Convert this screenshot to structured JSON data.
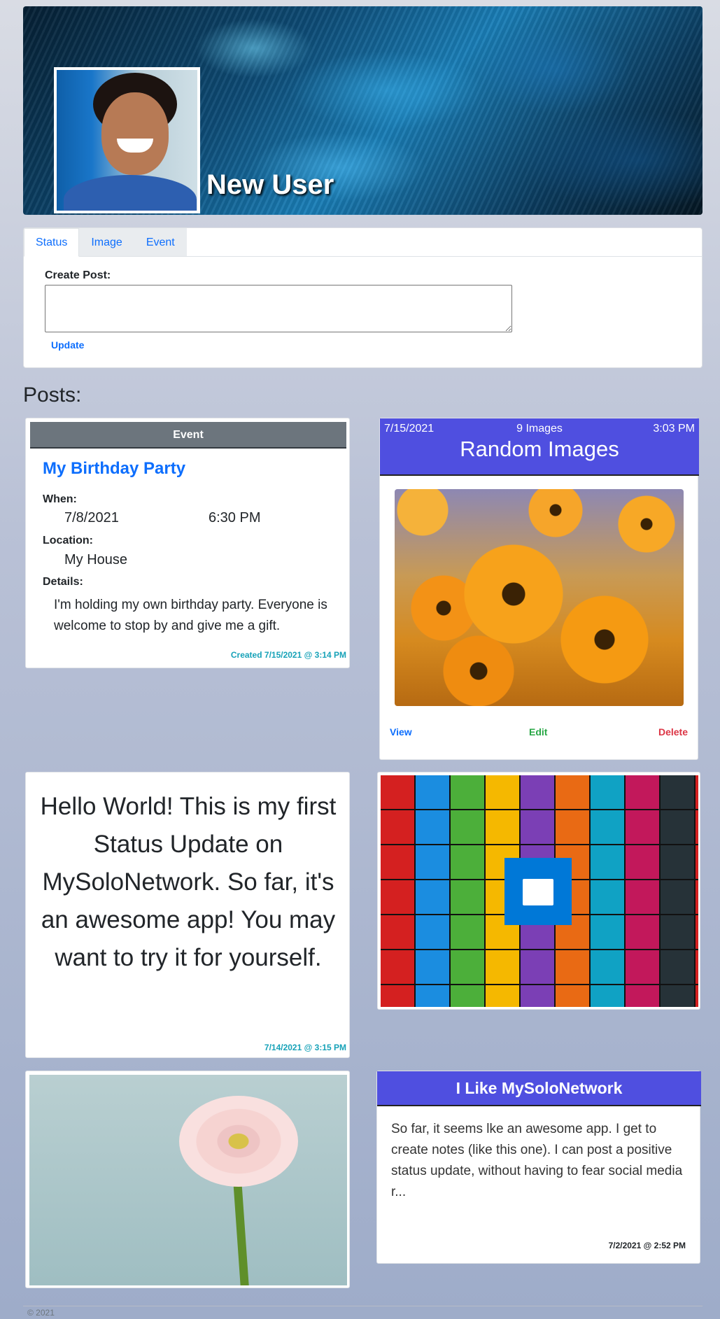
{
  "profile": {
    "name": "New User"
  },
  "create_post": {
    "tabs": [
      "Status",
      "Image",
      "Event"
    ],
    "active_tab": "Status",
    "label": "Create Post:",
    "textarea_value": "",
    "update_label": "Update"
  },
  "posts_heading": "Posts:",
  "event_post": {
    "header": "Event",
    "title": "My Birthday Party",
    "when_label": "When:",
    "date": "7/8/2021",
    "time": "6:30 PM",
    "location_label": "Location:",
    "location": "My House",
    "details_label": "Details:",
    "details": "I'm holding my own birthday party. Everyone is welcome to stop by and give me a gift.",
    "created": "Created 7/15/2021 @ 3:14 PM"
  },
  "images_post": {
    "date": "7/15/2021",
    "count": "9 Images",
    "time": "3:03 PM",
    "title": "Random Images",
    "view_label": "View",
    "edit_label": "Edit",
    "delete_label": "Delete"
  },
  "status_post": {
    "text": "Hello World! This is my first Status Update on MySoloNetwork. So far, it's an awesome app! You may want to try it for yourself.",
    "date": "7/14/2021 @ 3:15 PM"
  },
  "note_post": {
    "title": "I Like MySoloNetwork",
    "body": "So far, it seems lke an awesome app. I get to create notes (like this one). I can post a positive status update, without having to fear social media r...",
    "date": "7/2/2021 @ 2:52 PM"
  },
  "footer": "© 2021",
  "colors": {
    "accent_blue": "#0d6efd",
    "header_purple": "#4f4fe0",
    "event_header": "#6c757d",
    "teal_text": "#17a2b8",
    "edit_green": "#28a745",
    "delete_red": "#dc3545"
  }
}
